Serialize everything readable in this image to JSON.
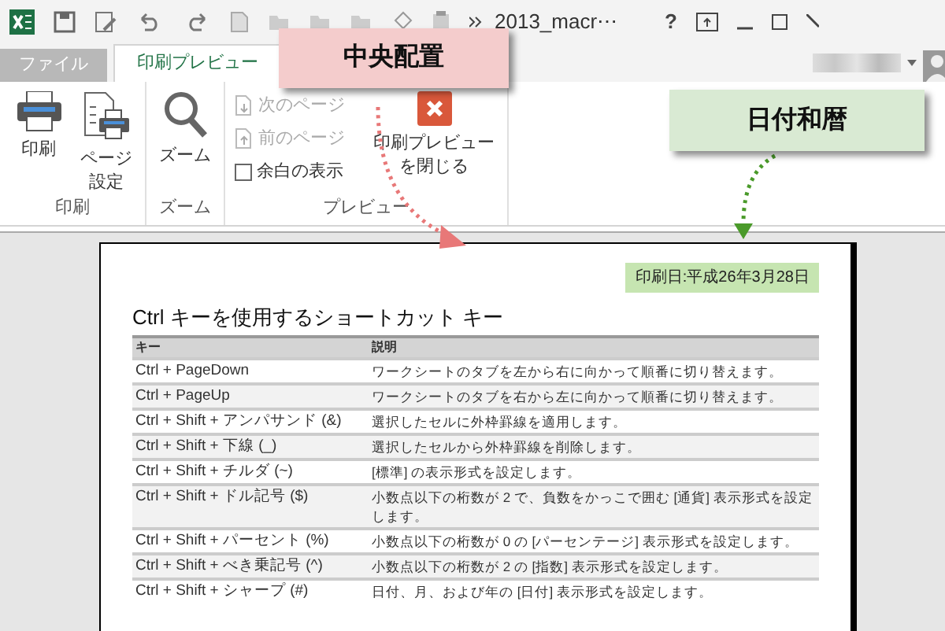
{
  "title_bar": {
    "filename": "2013_macr⋯",
    "help": "?"
  },
  "tabs": [
    {
      "label": "ファイル",
      "selected": false
    },
    {
      "label": "印刷プレビュー",
      "selected": true
    }
  ],
  "ribbon": {
    "groups": [
      {
        "label": "印刷",
        "items": [
          {
            "kind": "large",
            "label": "印刷"
          },
          {
            "kind": "large",
            "label": "ページ設定"
          }
        ]
      },
      {
        "label": "ズーム",
        "items": [
          {
            "kind": "large",
            "label": "ズーム"
          }
        ]
      },
      {
        "label": "プレビュー",
        "items": [
          {
            "kind": "small",
            "label": "次のページ",
            "disabled": true
          },
          {
            "kind": "small",
            "label": "前のページ",
            "disabled": true
          },
          {
            "kind": "check",
            "label": "余白の表示",
            "checked": false
          },
          {
            "kind": "large",
            "label": "印刷プレビューを閉じる"
          }
        ]
      }
    ]
  },
  "callouts": [
    {
      "label": "中央配置",
      "color": "#f4cccc"
    },
    {
      "label": "日付和暦",
      "color": "#d9ead3"
    }
  ],
  "page": {
    "print_date": "印刷日:平成26年3月28日",
    "heading": "Ctrl キーを使用するショートカット キー",
    "table": {
      "columns": [
        "キー",
        "説明"
      ],
      "rows": [
        [
          "Ctrl + PageDown",
          "ワークシートのタブを左から右に向かって順番に切り替えます。"
        ],
        [
          "Ctrl + PageUp",
          "ワークシートのタブを右から左に向かって順番に切り替えます。"
        ],
        [
          "Ctrl + Shift + アンパサンド (&)",
          "選択したセルに外枠罫線を適用します。"
        ],
        [
          "Ctrl + Shift + 下線 (_)",
          "選択したセルから外枠罫線を削除します。"
        ],
        [
          "Ctrl + Shift + チルダ (~)",
          "[標準] の表示形式を設定します。"
        ],
        [
          "Ctrl + Shift + ドル記号 ($)",
          "小数点以下の桁数が 2 で、負数をかっこで囲む [通貨] 表示形式を設定します。"
        ],
        [
          "Ctrl + Shift + パーセント (%)",
          "小数点以下の桁数が 0 の [パーセンテージ] 表示形式を設定します。"
        ],
        [
          "Ctrl + Shift + べき乗記号 (^)",
          "小数点以下の桁数が 2 の [指数] 表示形式を設定します。"
        ],
        [
          "Ctrl + Shift + シャープ (#)",
          "日付、月、および年の [日付] 表示形式を設定します。"
        ]
      ]
    }
  }
}
